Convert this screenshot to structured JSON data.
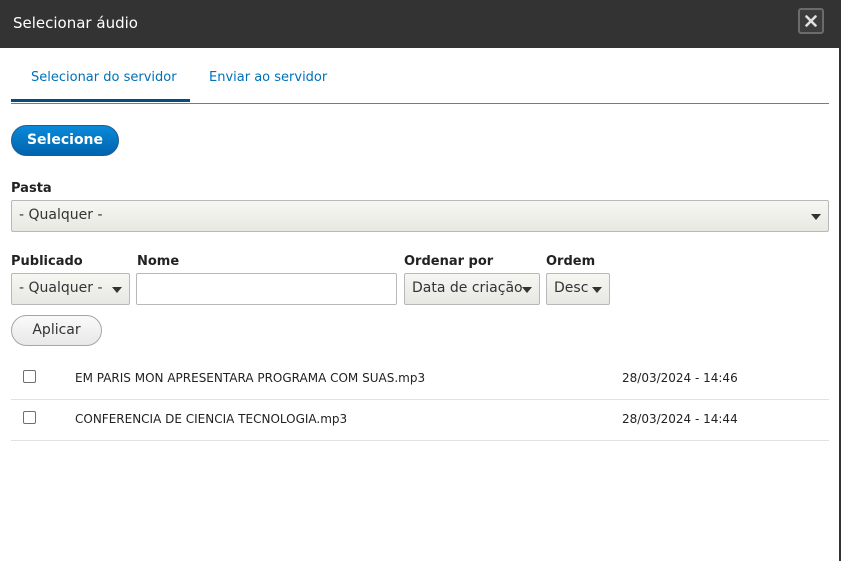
{
  "dialog": {
    "title": "Selecionar áudio",
    "close_icon": "close-icon"
  },
  "tabs": [
    {
      "label": "Selecionar do servidor",
      "active": true
    },
    {
      "label": "Enviar ao servidor",
      "active": false
    }
  ],
  "select_button": "Selecione",
  "filters": {
    "folder": {
      "label": "Pasta",
      "value": "- Qualquer -"
    },
    "published": {
      "label": "Publicado",
      "value": "- Qualquer -"
    },
    "name": {
      "label": "Nome",
      "value": ""
    },
    "sort_by": {
      "label": "Ordenar por",
      "value": "Data de criação"
    },
    "order": {
      "label": "Ordem",
      "value": "Desc"
    },
    "apply_button": "Aplicar"
  },
  "files": [
    {
      "name": "EM PARIS MON APRESENTARA PROGRAMA COM SUAS.mp3",
      "date": "28/03/2024 - 14:46",
      "checked": false
    },
    {
      "name": "CONFERENCIA DE CIENCIA TECNOLOGIA.mp3",
      "date": "28/03/2024 - 14:44",
      "checked": false
    }
  ],
  "colors": {
    "titlebar": "#333333",
    "accent": "#0071b8",
    "primary_button": "#0074bd"
  }
}
